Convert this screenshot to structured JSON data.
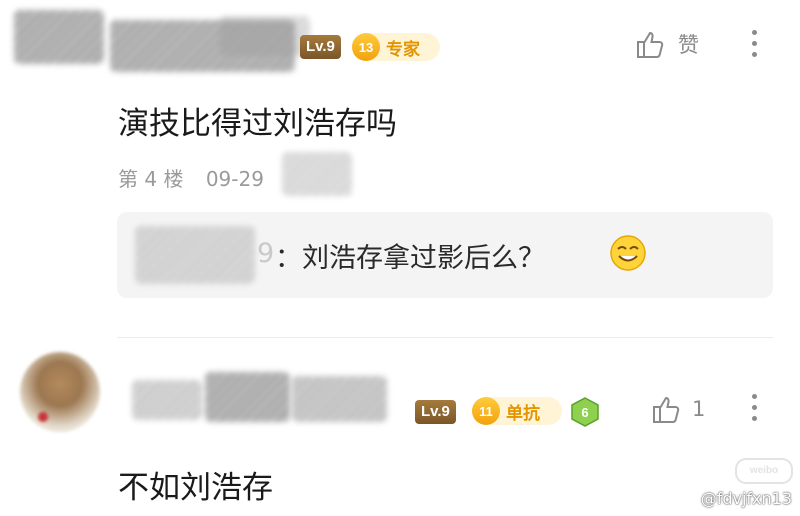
{
  "comment1": {
    "level": "Lv.9",
    "fan_level": "13",
    "fan_title": "专家",
    "like_label": "赞",
    "text": "演技比得过刘浩存吗",
    "floor": "第 4 楼",
    "date": "09-29"
  },
  "reply": {
    "author_suffix": "9",
    "text": "：刘浩存拿过影后么？",
    "emoji": "grinning-smug-emoji"
  },
  "comment2": {
    "level": "Lv.9",
    "fan_level": "11",
    "fan_title": "单抗",
    "badge": "6",
    "like_count": "1",
    "text": "不如刘浩存"
  },
  "watermark": {
    "logo": "weibo",
    "handle": "@fdvjfxn13"
  },
  "colors": {
    "accent": "#e59400",
    "level_bg": "#8a6230",
    "muted": "#9a9a9a"
  }
}
